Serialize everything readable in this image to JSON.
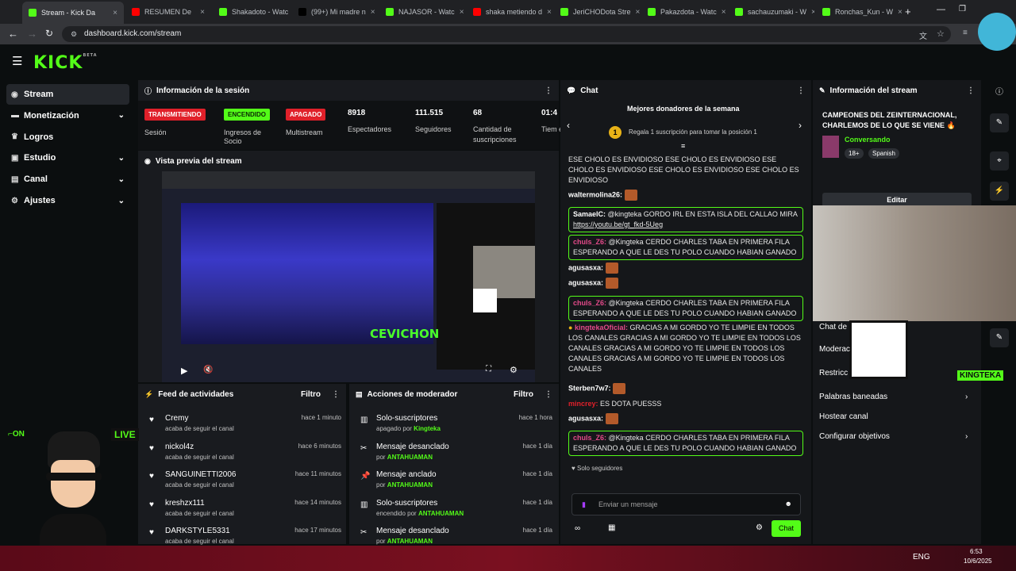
{
  "browser": {
    "tabs": [
      {
        "title": "Stream - Kick Da",
        "color": "#53fc18"
      },
      {
        "title": "RESUMEN De",
        "color": "#ff0000"
      },
      {
        "title": "Shakadoto - Watc",
        "color": "#53fc18"
      },
      {
        "title": "(99+) Mi madre n",
        "color": "#000000"
      },
      {
        "title": "NAJASOR - Watc",
        "color": "#53fc18"
      },
      {
        "title": "shaka metiendo d",
        "color": "#ff0000"
      },
      {
        "title": "JeriCHODota Stre",
        "color": "#53fc18"
      },
      {
        "title": "Pakazdota - Watc",
        "color": "#53fc18"
      },
      {
        "title": "sachauzumaki - W",
        "color": "#53fc18"
      },
      {
        "title": "Ronchas_Kun - W",
        "color": "#53fc18"
      }
    ],
    "url": "dashboard.kick.com/stream"
  },
  "app": {
    "logo": "KICK",
    "logo_sup": "BETA"
  },
  "sidebar": {
    "items": [
      {
        "label": "Stream",
        "icon": "stream-icon"
      },
      {
        "label": "Monetización",
        "icon": "money-icon"
      },
      {
        "label": "Logros",
        "icon": "trophy-icon"
      },
      {
        "label": "Estudio",
        "icon": "studio-icon"
      },
      {
        "label": "Canal",
        "icon": "channel-icon"
      },
      {
        "label": "Ajustes",
        "icon": "gear-icon"
      }
    ]
  },
  "session": {
    "title": "Información de la sesión",
    "stats": [
      {
        "value": "TRANSMITIENDO",
        "label": "Sesión",
        "type": "badge",
        "color": "#e0202a"
      },
      {
        "value": "ENCENDIDO",
        "label": "Ingresos de Socio",
        "type": "badge",
        "color": "#53fc18"
      },
      {
        "value": "APAGADO",
        "label": "Multistream",
        "type": "badge",
        "color": "#e0202a"
      },
      {
        "value": "8918",
        "label": "Espectadores"
      },
      {
        "value": "111.515",
        "label": "Seguidores"
      },
      {
        "value": "68",
        "label": "Cantidad de suscripciones"
      },
      {
        "value": "01:4",
        "label": "Tiem en vi"
      }
    ]
  },
  "preview": {
    "title": "Vista previa del stream",
    "overlay_text": "CEVICHON"
  },
  "feed": {
    "title": "Feed de actividades",
    "filter": "Filtro",
    "items": [
      {
        "name": "Cremy",
        "sub": "acaba de seguir el canal",
        "time": "hace 1 minuto"
      },
      {
        "name": "nickol4z",
        "sub": "acaba de seguir el canal",
        "time": "hace 6 minutos"
      },
      {
        "name": "SANGUINETTI2006",
        "sub": "acaba de seguir el canal",
        "time": "hace 11 minutos"
      },
      {
        "name": "kreshzx111",
        "sub": "acaba de seguir el canal",
        "time": "hace 14 minutos"
      },
      {
        "name": "DARKSTYLE5331",
        "sub": "acaba de seguir el canal",
        "time": "hace 17 minutos"
      }
    ]
  },
  "mod": {
    "title": "Acciones de moderador",
    "filter": "Filtro",
    "items": [
      {
        "name": "Solo-suscriptores",
        "sub": "apagado por",
        "who": "Kingteka",
        "time": "hace 1 hora"
      },
      {
        "name": "Mensaje desanclado",
        "sub": "por",
        "who": "ANTAHUAMAN",
        "time": "hace 1 día"
      },
      {
        "name": "Mensaje anclado",
        "sub": "por",
        "who": "ANTAHUAMAN",
        "time": "hace 1 día"
      },
      {
        "name": "Solo-suscriptores",
        "sub": "encendido por",
        "who": "ANTAHUAMAN",
        "time": "hace 1 día"
      },
      {
        "name": "Mensaje desanclado",
        "sub": "por",
        "who": "ANTAHUAMAN",
        "time": "hace 1 día"
      }
    ]
  },
  "chat": {
    "title": "Chat",
    "donors_title": "Mejores donadores de la semana",
    "donors_rank": "1",
    "donors_sub": "Regala 1 suscripción para tomar la posición 1",
    "messages": [
      {
        "user": "",
        "text": "ESE CHOLO ES ENVIDIOSO ESE CHOLO ES ENVIDIOSO ESE CHOLO ES ENVIDIOSO ESE CHOLO ES ENVIDIOSO ESE CHOLO ES ENVIDIOSO",
        "color": "#ffffff"
      },
      {
        "user": "waltermolina26:",
        "text": "",
        "color": "#ffffff"
      },
      {
        "user": "SamaelC:",
        "text": "@kingteka GORDO IRL EN ESTA ISLA DEL CALLAO MIRA",
        "link": "https://youtu.be/gt_fkd-5Ueg",
        "color": "#ffffff",
        "box": true
      },
      {
        "user": "chuls_Z6:",
        "text": "@Kingteka CERDO CHARLES TABA EN PRIMERA FILA ESPERANDO A QUE LE DES TU POLO CUANDO HABIAN GANADO",
        "color": "#e44a8a",
        "box": true
      },
      {
        "user": "agusasxa:",
        "text": "",
        "color": "#ffffff"
      },
      {
        "user": "agusasxa:",
        "text": "",
        "color": "#ffffff"
      },
      {
        "user": "chuls_Z6:",
        "text": "@Kingteka CERDO CHARLES TABA EN PRIMERA FILA ESPERANDO A QUE LE DES TU POLO CUANDO HABIAN GANADO",
        "color": "#e44a8a",
        "box": true
      },
      {
        "user": "kingtekaOficial:",
        "text": "GRACIAS A MI GORDO YO TE LIMPIE EN TODOS LOS CANALES GRACIAS A MI GORDO YO TE LIMPIE EN TODOS LOS CANALES GRACIAS A MI GORDO YO TE LIMPIE EN TODOS LOS CANALES GRACIAS A MI GORDO YO TE LIMPIE EN TODOS LOS CANALES",
        "color": "#e44a8a"
      },
      {
        "user": "Sterben7w7:",
        "text": "",
        "color": "#ffffff"
      },
      {
        "user": "mincrey:",
        "text": "ES DOTA PUESSS",
        "color": "#e0202a"
      },
      {
        "user": "agusasxa:",
        "text": "",
        "color": "#ffffff"
      },
      {
        "user": "chuls_Z6:",
        "text": "@Kingteka CERDO CHARLES TABA EN PRIMERA FILA ESPERANDO A QUE LE DES TU POLO CUANDO HABIAN GANADO",
        "color": "#e44a8a",
        "box": true
      }
    ],
    "followers_only": "Solo seguidores",
    "input_placeholder": "Enviar un mensaje",
    "send_label": "Chat"
  },
  "streaminfo": {
    "title": "Información del stream",
    "stream_title": "CAMPEONES DEL ZEINTERNACIONAL, CHARLEMOS DE LO QUE SE VIENE",
    "category": "Conversando",
    "tags": [
      "18+",
      "Spanish"
    ],
    "edit_label": "Editar",
    "links": [
      {
        "label": "Chat de",
        "chev": false
      },
      {
        "label": "Moderac",
        "chev": false
      },
      {
        "label": "Restricc",
        "chev": false
      },
      {
        "label": "Palabras baneadas",
        "chev": true
      },
      {
        "label": "Hostear canal",
        "chev": false
      },
      {
        "label": "Configurar objetivos",
        "chev": true
      }
    ],
    "cam_tag": "KINGTEKA",
    "cam_tag_color": "#53fc18"
  },
  "overlay": {
    "on_label": "ON",
    "live_label": "LIVE"
  },
  "taskbar": {
    "lang": "ENG",
    "time": "6:53",
    "date": "10/6/2025"
  }
}
